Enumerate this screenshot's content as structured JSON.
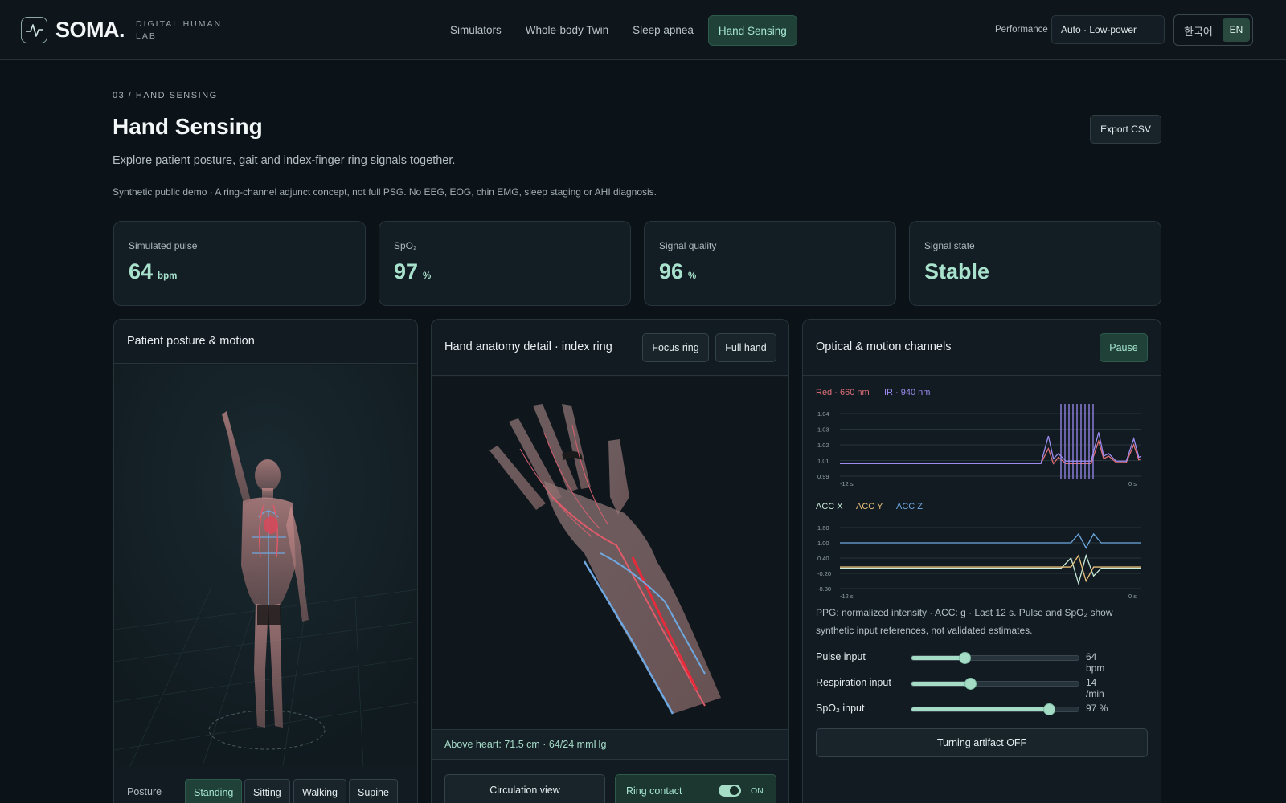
{
  "header": {
    "brand": "SOMA.",
    "brand_sub_line1": "DIGITAL HUMAN",
    "brand_sub_line2": "LAB",
    "nav": [
      {
        "label": "Simulators",
        "active": false
      },
      {
        "label": "Whole-body Twin",
        "active": false
      },
      {
        "label": "Sleep apnea",
        "active": false
      },
      {
        "label": "Hand Sensing",
        "active": true
      }
    ],
    "performance_label": "Performance",
    "performance_value": "Auto · Low-power",
    "lang_ko": "한국어",
    "lang_en": "EN"
  },
  "page": {
    "breadcrumb": "03 / HAND SENSING",
    "title": "Hand Sensing",
    "subtitle": "Explore patient posture, gait and index-finger ring signals together.",
    "disclaimer": "Synthetic public demo · A ring-channel adjunct concept, not full PSG. No EEG, EOG, chin EMG, sleep staging or AHI diagnosis.",
    "export_label": "Export CSV"
  },
  "metrics": [
    {
      "label": "Simulated pulse",
      "value": "64",
      "unit": "bpm"
    },
    {
      "label": "SpO₂",
      "value": "97",
      "unit": "%"
    },
    {
      "label": "Signal quality",
      "value": "96",
      "unit": "%"
    },
    {
      "label": "Signal state",
      "value": "Stable",
      "unit": ""
    }
  ],
  "posture_panel": {
    "title": "Patient posture & motion",
    "posture_label": "Posture",
    "options": [
      {
        "label": "Standing",
        "active": true
      },
      {
        "label": "Sitting",
        "active": false
      },
      {
        "label": "Walking",
        "active": false
      },
      {
        "label": "Supine",
        "active": false
      }
    ]
  },
  "hand_panel": {
    "title": "Hand anatomy detail · index ring",
    "focus_label": "Focus ring",
    "full_label": "Full hand",
    "status": "Above heart: 71.5 cm · 64/24 mmHg",
    "circulation_label": "Circulation view",
    "ring_contact_label": "Ring contact",
    "ring_contact_state": "ON"
  },
  "channels_panel": {
    "title": "Optical & motion channels",
    "pause_label": "Pause",
    "note": "PPG: normalized intensity · ACC: g · Last 12 s. Pulse and SpO₂ show synthetic input references, not validated estimates.",
    "sliders": [
      {
        "label": "Pulse input",
        "value": "64 bpm",
        "fraction": 0.32
      },
      {
        "label": "Respiration input",
        "value": "14 /min",
        "fraction": 0.35
      },
      {
        "label": "SpO₂ input",
        "value": "97 %",
        "fraction": 0.82
      }
    ],
    "artifact_label": "Turning artifact OFF",
    "colors": {
      "red": "#e2707a",
      "ir": "#9d8cf0",
      "accx": "#c7ead9",
      "accy": "#e8c07a",
      "accz": "#6fa8e0"
    }
  },
  "chart_data": [
    {
      "type": "line",
      "title": "",
      "legend": [
        "Red · 660 nm",
        "IR · 940 nm"
      ],
      "x_tick_labels": [
        "-12 s",
        "0 s"
      ],
      "y_tick_labels": [
        "1.04",
        "1.03",
        "1.02",
        "1.01",
        "0.99"
      ],
      "ylim": [
        0.99,
        1.04
      ],
      "xlim": [
        -12,
        0
      ],
      "series": [
        {
          "name": "Red · 660 nm",
          "x": [
            -12,
            -4.0,
            -3.7,
            -3.5,
            -3.3,
            -3.0,
            -2.5,
            -2.0,
            -1.7,
            -1.5,
            -1.3,
            -1.0,
            -0.6,
            -0.3,
            -0.1,
            0
          ],
          "y": [
            1.0,
            1.0,
            1.012,
            1.0,
            1.005,
            1.0,
            1.0,
            1.0,
            1.018,
            1.004,
            1.006,
            1.001,
            1.001,
            1.015,
            1.003,
            1.004
          ]
        },
        {
          "name": "IR · 940 nm",
          "x": [
            -12,
            -4.0,
            -3.7,
            -3.5,
            -3.3,
            -3.0,
            -2.5,
            -2.0,
            -1.7,
            -1.5,
            -1.3,
            -1.0,
            -0.6,
            -0.3,
            -0.1,
            0
          ],
          "y": [
            1.0,
            1.0,
            1.022,
            1.004,
            1.008,
            1.002,
            1.002,
            1.002,
            1.025,
            1.006,
            1.008,
            1.002,
            1.002,
            1.02,
            1.005,
            1.006
          ]
        }
      ]
    },
    {
      "type": "line",
      "title": "",
      "legend": [
        "ACC X",
        "ACC Y",
        "ACC Z"
      ],
      "x_tick_labels": [
        "-12 s",
        "0 s"
      ],
      "y_tick_labels": [
        "1.60",
        "1.00",
        "0.40",
        "-0.20",
        "-0.80"
      ],
      "ylim": [
        -0.8,
        1.6
      ],
      "xlim": [
        -12,
        0
      ],
      "series": [
        {
          "name": "ACC X",
          "x": [
            -12,
            -3.2,
            -2.8,
            -2.5,
            -2.2,
            -1.9,
            -1.6,
            0
          ],
          "y": [
            0.0,
            0.0,
            0.4,
            -0.6,
            0.5,
            -0.3,
            0.0,
            0.0
          ]
        },
        {
          "name": "ACC Y",
          "x": [
            -12,
            -3.2,
            -2.8,
            -2.5,
            -2.2,
            -1.9,
            -1.6,
            0
          ],
          "y": [
            0.05,
            0.05,
            0.05,
            0.5,
            -0.5,
            0.05,
            0.05,
            0.05
          ]
        },
        {
          "name": "ACC Z",
          "x": [
            -12,
            -3.2,
            -2.8,
            -2.5,
            -2.2,
            -1.9,
            -1.6,
            0
          ],
          "y": [
            1.0,
            1.0,
            1.0,
            1.35,
            0.8,
            1.35,
            1.0,
            1.0
          ]
        }
      ]
    }
  ]
}
